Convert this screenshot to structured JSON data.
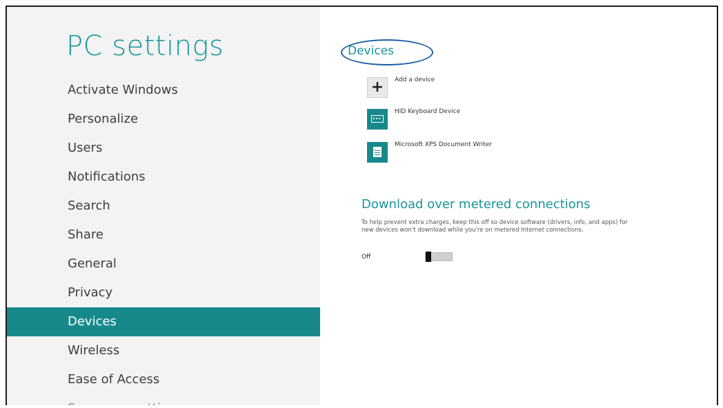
{
  "sidebar": {
    "title": "PC settings",
    "items": [
      {
        "label": "Activate Windows",
        "active": false
      },
      {
        "label": "Personalize",
        "active": false
      },
      {
        "label": "Users",
        "active": false
      },
      {
        "label": "Notifications",
        "active": false
      },
      {
        "label": "Search",
        "active": false
      },
      {
        "label": "Share",
        "active": false
      },
      {
        "label": "General",
        "active": false
      },
      {
        "label": "Privacy",
        "active": false
      },
      {
        "label": "Devices",
        "active": true
      },
      {
        "label": "Wireless",
        "active": false
      },
      {
        "label": "Ease of Access",
        "active": false
      },
      {
        "label": "Sync your settings",
        "active": false
      }
    ]
  },
  "main": {
    "section_title": "Devices",
    "devices": [
      {
        "label": "Add a device",
        "icon": "plus-icon"
      },
      {
        "label": "HID Keyboard Device",
        "icon": "keyboard-icon"
      },
      {
        "label": "Microsoft XPS Document Writer",
        "icon": "document-printer-icon"
      }
    ],
    "metered": {
      "title": "Download over metered connections",
      "description": "To help prevent extra charges, keep this off so device software (drivers, info, and apps) for new devices won't download while you're on metered Internet connections.",
      "toggle_label": "Off",
      "toggle_on": false
    }
  },
  "colors": {
    "accent": "#18898b",
    "sidebar_bg": "#f3f3f3",
    "highlight_circle": "#1a5da0"
  }
}
